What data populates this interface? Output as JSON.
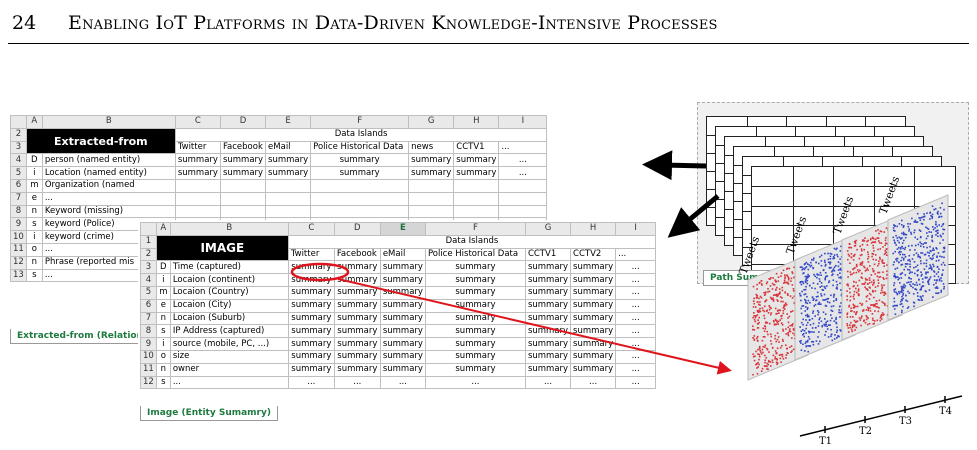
{
  "header": {
    "page_number": "24",
    "running_title": "Enabling IoT Platforms in Data-Driven Knowledge-Intensive Processes"
  },
  "sheet_back": {
    "columns": [
      "A",
      "B",
      "C",
      "D",
      "E",
      "F",
      "G",
      "H",
      "I"
    ],
    "title": "Extracted-from",
    "group_header": "Data Islands",
    "subheaders": [
      "Twitter",
      "Facebook",
      "eMail",
      "Police Historical Data",
      "news",
      "CCTV1",
      "..."
    ],
    "rows": [
      {
        "num": "4",
        "letter": "D",
        "label": "person (named entity)",
        "values": [
          "summary",
          "summary",
          "summary",
          "summary",
          "summary",
          "summary",
          "..."
        ]
      },
      {
        "num": "5",
        "letter": "i",
        "label": "Location (named entity)",
        "values": [
          "summary",
          "summary",
          "summary",
          "summary",
          "summary",
          "summary",
          "..."
        ]
      },
      {
        "num": "6",
        "letter": "m",
        "label": "Organization (named",
        "values": []
      },
      {
        "num": "7",
        "letter": "e",
        "label": "...",
        "values": []
      },
      {
        "num": "8",
        "letter": "n",
        "label": "Keyword (missing)",
        "values": []
      },
      {
        "num": "9",
        "letter": "s",
        "label": "keyword (Police)",
        "values": []
      },
      {
        "num": "10",
        "letter": "i",
        "label": "keyword (crime)",
        "values": []
      },
      {
        "num": "11",
        "letter": "o",
        "label": "...",
        "values": []
      },
      {
        "num": "12",
        "letter": "n",
        "label": "Phrase (reported mis",
        "values": []
      },
      {
        "num": "13",
        "letter": "s",
        "label": "...",
        "values": []
      }
    ],
    "tab": "Extracted-from (Relationsh"
  },
  "sheet_front": {
    "columns": [
      "A",
      "B",
      "C",
      "D",
      "E",
      "F",
      "G",
      "H",
      "I"
    ],
    "title": "IMAGE",
    "group_header": "Data Islands",
    "subheaders": [
      "Twitter",
      "Facebook",
      "eMail",
      "Police Historical Data",
      "CCTV1",
      "CCTV2",
      "..."
    ],
    "rows": [
      {
        "num": "3",
        "letter": "D",
        "label": "Time (captured)",
        "values": [
          "summary",
          "summary",
          "summary",
          "summary",
          "summary",
          "summary",
          "..."
        ]
      },
      {
        "num": "4",
        "letter": "i",
        "label": "Locaion (continent)",
        "values": [
          "summary",
          "summary",
          "summary",
          "summary",
          "summary",
          "summary",
          "..."
        ]
      },
      {
        "num": "5",
        "letter": "m",
        "label": "Locaion (Country)",
        "values": [
          "summary",
          "summary",
          "summary",
          "summary",
          "summary",
          "summary",
          "..."
        ]
      },
      {
        "num": "6",
        "letter": "e",
        "label": "Locaion (City)",
        "values": [
          "summary",
          "summary",
          "summary",
          "summary",
          "summary",
          "summary",
          "..."
        ]
      },
      {
        "num": "7",
        "letter": "n",
        "label": "Locaion (Suburb)",
        "values": [
          "summary",
          "summary",
          "summary",
          "summary",
          "summary",
          "summary",
          "..."
        ]
      },
      {
        "num": "8",
        "letter": "s",
        "label": "IP Address (captured)",
        "values": [
          "summary",
          "summary",
          "summary",
          "summary",
          "summary",
          "summary",
          "..."
        ]
      },
      {
        "num": "9",
        "letter": "i",
        "label": "source (mobile, PC, ...)",
        "values": [
          "summary",
          "summary",
          "summary",
          "summary",
          "summary",
          "summary",
          "..."
        ]
      },
      {
        "num": "10",
        "letter": "o",
        "label": "size",
        "values": [
          "summary",
          "summary",
          "summary",
          "summary",
          "summary",
          "summary",
          "..."
        ]
      },
      {
        "num": "11",
        "letter": "n",
        "label": "owner",
        "values": [
          "summary",
          "summary",
          "summary",
          "summary",
          "summary",
          "summary",
          "..."
        ]
      },
      {
        "num": "12",
        "letter": "s",
        "label": "...",
        "values": [
          "...",
          "...",
          "...",
          "...",
          "...",
          "...",
          "..."
        ]
      }
    ],
    "tab": "Image (Entity Sumamry)"
  },
  "path_summary": {
    "label": "Path Summary"
  },
  "tweets_panel": {
    "panel_labels": [
      "Tweets",
      "Tweets",
      "Tweets",
      "Tweets"
    ],
    "time_labels": [
      "T1",
      "T2",
      "T3",
      "T4"
    ],
    "panel_colors": [
      "#d9343a",
      "#3146c8",
      "#d9343a",
      "#3146c8"
    ]
  },
  "colors": {
    "highlight": "#e0141c",
    "sheet_tab_text": "#1f7a40",
    "selected_column": "#1f6f3f"
  }
}
